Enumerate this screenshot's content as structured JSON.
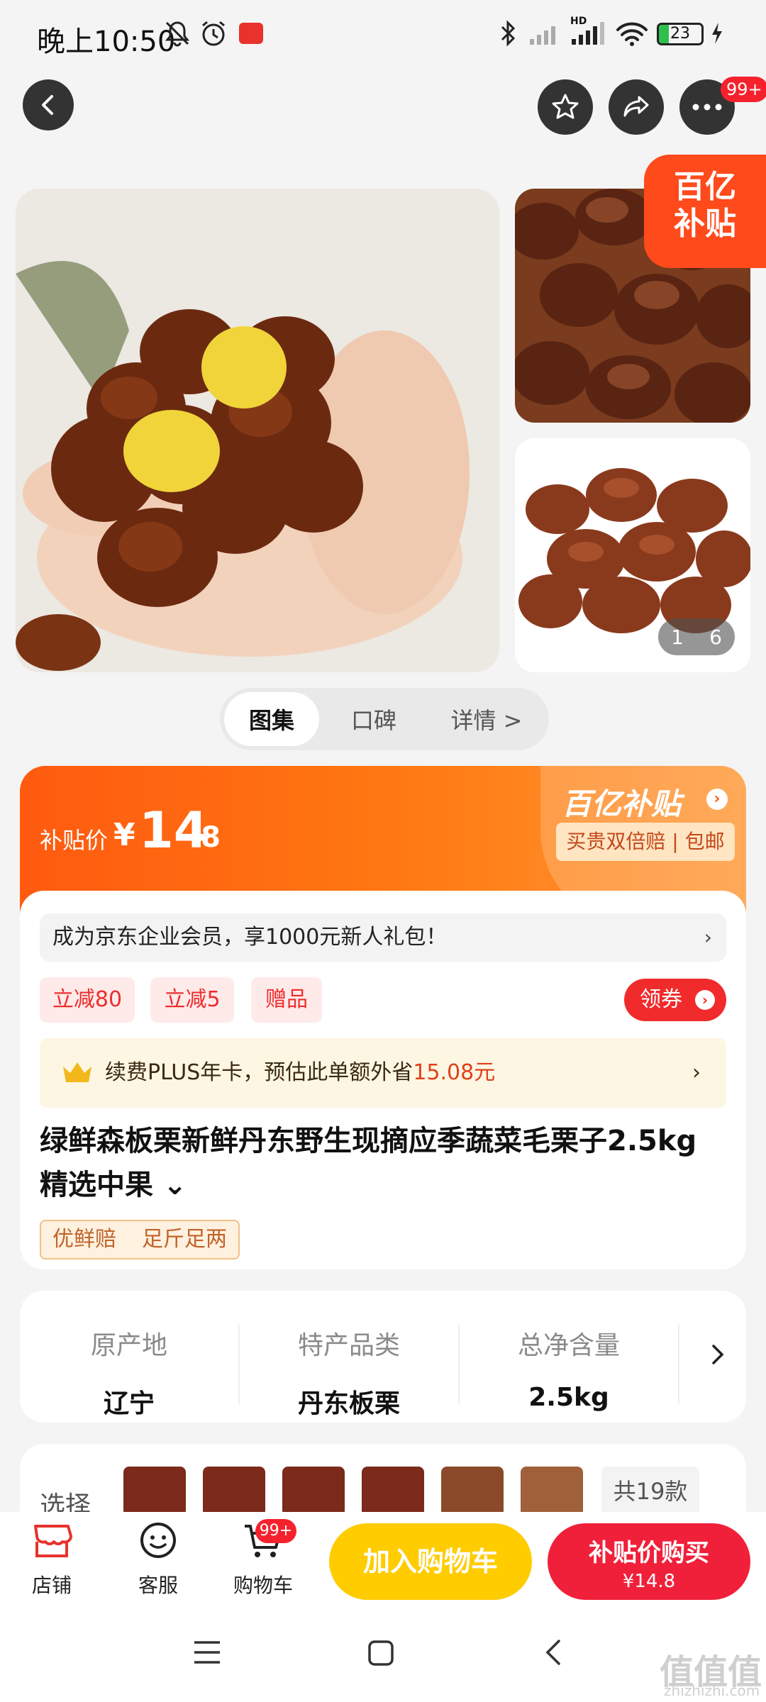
{
  "status_bar": {
    "time": "晚上10:50",
    "battery": "23",
    "battery_level": 0.23,
    "hd_label": "HD"
  },
  "nav": {
    "more_badge": "99+"
  },
  "gallery": {
    "subsidy_corner_l1": "百亿",
    "subsidy_corner_l2": "补贴",
    "pager_current": "1",
    "pager_total": "6"
  },
  "tabs": [
    {
      "label": "图集"
    },
    {
      "label": "口碑"
    },
    {
      "label": "详情 >"
    }
  ],
  "price": {
    "label": "补贴价",
    "currency": "¥",
    "integer": "14",
    "decimal": ".8",
    "subsidy_logo": "百亿补贴",
    "subsidy_tag": "买贵双倍赔 | 包邮"
  },
  "promo": {
    "member_text": "成为京东企业会员，享1000元新人礼包！",
    "chev": "›",
    "pills": [
      "立减80",
      "立减5",
      "赠品"
    ],
    "coupon": "领券",
    "plus_prefix": "续费PLUS年卡，预估此单额外省",
    "plus_amount": "15.08元"
  },
  "product": {
    "title": "绿鲜森板栗新鲜丹东野生现摘应季蔬菜毛栗子2.5kg精选中果 ⌄",
    "tags": [
      "优鲜赔",
      "足斤足两"
    ]
  },
  "specs": [
    {
      "key": "原产地",
      "value": "辽宁"
    },
    {
      "key": "特产品类",
      "value": "丹东板栗"
    },
    {
      "key": "总净含量",
      "value": "2.5kg"
    }
  ],
  "choose": {
    "label": "选择",
    "more": "共19款"
  },
  "bottom_bar": {
    "shop": "店铺",
    "service": "客服",
    "cart": "购物车",
    "cart_badge": "99+",
    "add_to_cart": "加入购物车",
    "buy_l1": "补贴价购买",
    "buy_l2": "¥14.8"
  },
  "watermark": {
    "main": "值值值",
    "sub": "zhizhizhi.com"
  },
  "colors": {
    "accent_orange": "#ff5a10",
    "buy_red": "#f0203a",
    "cart_yellow": "#ffcc00"
  }
}
